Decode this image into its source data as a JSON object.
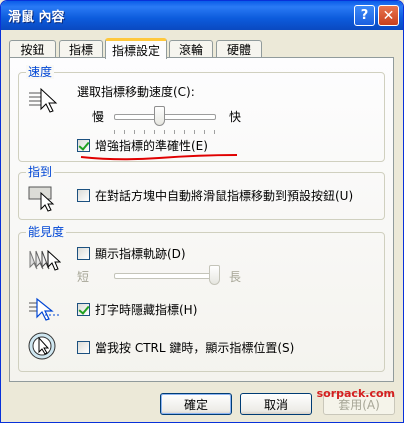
{
  "window": {
    "title": "滑鼠 內容",
    "help_glyph": "?",
    "close_glyph": "✕"
  },
  "tabs": [
    {
      "label": "按鈕"
    },
    {
      "label": "指標"
    },
    {
      "label": "指標設定",
      "active": true
    },
    {
      "label": "滾輪"
    },
    {
      "label": "硬體"
    }
  ],
  "speed_group": {
    "legend": "速度",
    "prompt": "選取指標移動速度(C):",
    "slow": "慢",
    "fast": "快",
    "speed_value": 0.45,
    "enhance_label": "增強指標的準確性(E)",
    "enhance_checked": true
  },
  "snap_group": {
    "legend": "指到",
    "label": "在對話方塊中自動將滑鼠指標移動到預設按鈕(U)",
    "checked": false
  },
  "visibility_group": {
    "legend": "能見度",
    "trails_label": "顯示指標軌跡(D)",
    "trails_checked": false,
    "short": "短",
    "long": "長",
    "trails_value": 1.0,
    "hide_label": "打字時隱藏指標(H)",
    "hide_checked": true,
    "ctrl_label": "當我按 CTRL 鍵時，顯示指標位置(S)",
    "ctrl_checked": false
  },
  "buttons": {
    "ok": "確定",
    "cancel": "取消",
    "apply": "套用(A)"
  },
  "watermark": "sorpack.com",
  "colors": {
    "accent": "#0046d5",
    "underline": "#e00000",
    "check": "#21a121"
  }
}
